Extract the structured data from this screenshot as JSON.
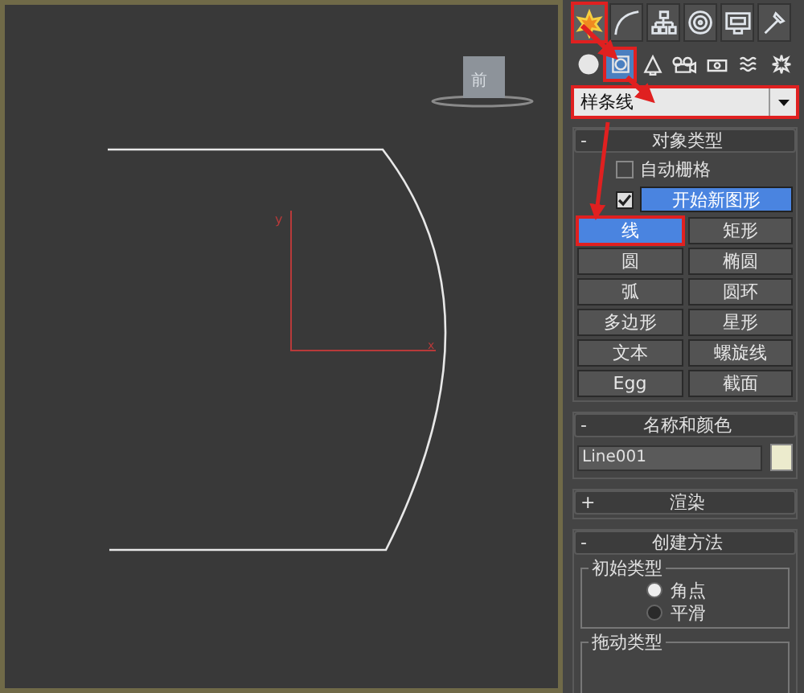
{
  "viewport": {
    "viewcube_label": "前",
    "axis_y": "y",
    "axis_x": "x"
  },
  "command_tabs": [
    {
      "kind": "create",
      "selected": true,
      "highlighted": true
    },
    {
      "kind": "modify",
      "selected": false,
      "highlighted": false
    },
    {
      "kind": "hierarchy",
      "selected": false,
      "highlighted": false
    },
    {
      "kind": "motion",
      "selected": false,
      "highlighted": false
    },
    {
      "kind": "display",
      "selected": false,
      "highlighted": false
    },
    {
      "kind": "utilities",
      "selected": false,
      "highlighted": false
    }
  ],
  "category_icons": [
    {
      "kind": "geometry",
      "selected": false,
      "highlighted": false
    },
    {
      "kind": "shapes",
      "selected": true,
      "highlighted": true
    },
    {
      "kind": "lights",
      "selected": false,
      "highlighted": false
    },
    {
      "kind": "cameras",
      "selected": false,
      "highlighted": false
    },
    {
      "kind": "helpers",
      "selected": false,
      "highlighted": false
    },
    {
      "kind": "spacewarps",
      "selected": false,
      "highlighted": false
    },
    {
      "kind": "systems",
      "selected": false,
      "highlighted": false
    }
  ],
  "dropdown": {
    "value": "样条线",
    "highlighted": true
  },
  "object_type": {
    "toggle": "-",
    "title": "对象类型",
    "auto_grid": {
      "label": "自动栅格",
      "checked": false
    },
    "start_new_shape": {
      "label": "开始新图形",
      "checked": true
    },
    "buttons": [
      {
        "label": "线",
        "selected": true,
        "highlighted": true
      },
      {
        "label": "矩形",
        "selected": false,
        "highlighted": false
      },
      {
        "label": "圆",
        "selected": false,
        "highlighted": false
      },
      {
        "label": "椭圆",
        "selected": false,
        "highlighted": false
      },
      {
        "label": "弧",
        "selected": false,
        "highlighted": false
      },
      {
        "label": "圆环",
        "selected": false,
        "highlighted": false
      },
      {
        "label": "多边形",
        "selected": false,
        "highlighted": false
      },
      {
        "label": "星形",
        "selected": false,
        "highlighted": false
      },
      {
        "label": "文本",
        "selected": false,
        "highlighted": false
      },
      {
        "label": "螺旋线",
        "selected": false,
        "highlighted": false
      },
      {
        "label": "Egg",
        "selected": false,
        "highlighted": false
      },
      {
        "label": "截面",
        "selected": false,
        "highlighted": false
      }
    ]
  },
  "name_and_color": {
    "toggle": "-",
    "title": "名称和颜色",
    "name": "Line001",
    "color": "#ecebcd"
  },
  "rendering": {
    "toggle": "+",
    "title": "渲染"
  },
  "creation_method": {
    "toggle": "-",
    "title": "创建方法",
    "initial_type": {
      "title": "初始类型",
      "options": [
        {
          "label": "角点",
          "selected": true
        },
        {
          "label": "平滑",
          "selected": false
        }
      ]
    },
    "drag_type": {
      "title": "拖动类型"
    }
  }
}
